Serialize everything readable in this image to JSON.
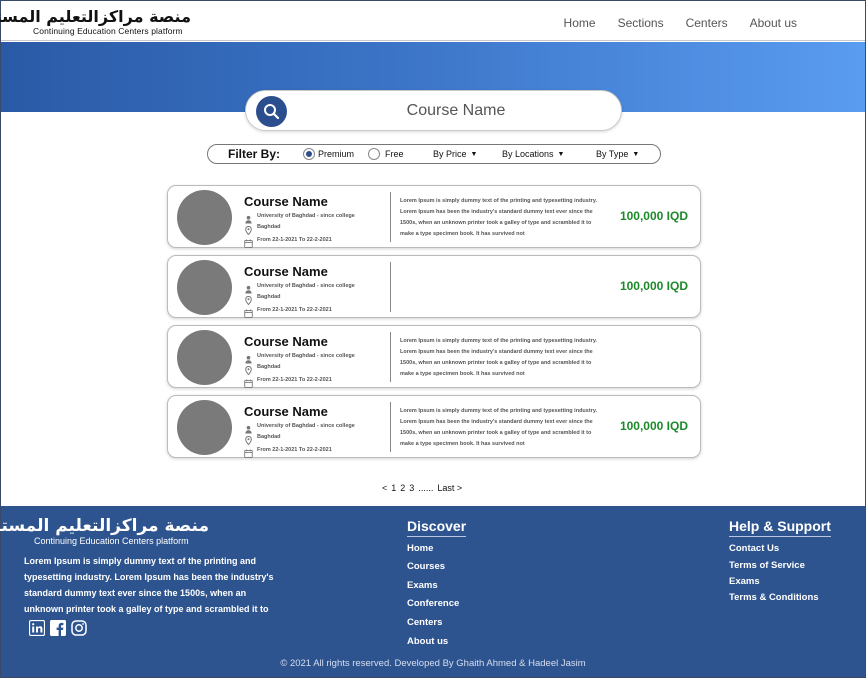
{
  "header": {
    "logo_ar": "منصة مراكزالتعليم المستمر",
    "logo_en": "Continuing Education Centers platform",
    "nav": [
      "Home",
      "Sections",
      "Centers",
      "About us"
    ]
  },
  "search": {
    "placeholder": "Course Name",
    "icon": "search-icon"
  },
  "filter": {
    "label": "Filter By:",
    "radios": [
      {
        "label": "Premium",
        "selected": true
      },
      {
        "label": "Free",
        "selected": false
      }
    ],
    "dropdowns": [
      "By Price",
      "By Locations",
      "By Type"
    ]
  },
  "courses": [
    {
      "title": "Course Name",
      "org": "University of Baghdad - since college",
      "city": "Baghdad",
      "dates": "From 22-1-2021 To 22-2-2021",
      "desc": "Lorem Ipsum is simply dummy text of the printing and typesetting industry. Lorem Ipsum has been the industry's standard dummy text ever since the 1500s, when an unknown printer took a galley of type and scrambled it to make a type specimen book. It has survived not",
      "price": "100,000 IQD"
    },
    {
      "title": "Course Name",
      "org": "University of Baghdad - since college",
      "city": "Baghdad",
      "dates": "From 22-1-2021 To 22-2-2021",
      "desc": "",
      "price": "100,000 IQD"
    },
    {
      "title": "Course Name",
      "org": "University of Baghdad - since college",
      "city": "Baghdad",
      "dates": "From 22-1-2021 To 22-2-2021",
      "desc": "Lorem Ipsum is simply dummy text of the printing and typesetting industry. Lorem Ipsum has been the industry's standard dummy text ever since the 1500s, when an unknown printer took a galley of type and scrambled it to make a type specimen book. It has survived not",
      "price": ""
    },
    {
      "title": "Course Name",
      "org": "University of Baghdad - since college",
      "city": "Baghdad",
      "dates": "From 22-1-2021 To 22-2-2021",
      "desc": "Lorem Ipsum is simply dummy text of the printing and typesetting industry. Lorem Ipsum has been the industry's standard dummy text ever since the 1500s, when an unknown printer took a galley of type and scrambled it to make a type specimen book. It has survived not",
      "price": "100,000 IQD"
    }
  ],
  "pagination": {
    "prev": "<",
    "pages": [
      "1",
      "2",
      "3"
    ],
    "ellipsis": "......",
    "last": "Last >"
  },
  "footer": {
    "logo_ar": "منصة مراكزالتعليم المستمر",
    "logo_en": "Continuing Education Centers platform",
    "about": "Lorem Ipsum is simply dummy text of the printing and typesetting industry. Lorem Ipsum has been the industry's standard dummy text ever since the 1500s, when an unknown printer took a galley of type and scrambled it to",
    "social": [
      "linkedin-icon",
      "facebook-icon",
      "instagram-icon"
    ],
    "discover": {
      "title": "Discover",
      "links": [
        "Home",
        "Courses",
        "Exams",
        "Conference",
        "Centers",
        "About us"
      ]
    },
    "help": {
      "title": "Help & Support",
      "links": [
        "Contact Us",
        "Terms of Service",
        "Exams",
        "Terms & Conditions"
      ]
    },
    "copyright": "© 2021 All rights reserved. Developed By Ghaith Ahmed & Hadeel Jasim"
  },
  "colors": {
    "primary": "#2e5490",
    "price": "#1d8a2a",
    "hero_end": "#5a9cf0"
  }
}
